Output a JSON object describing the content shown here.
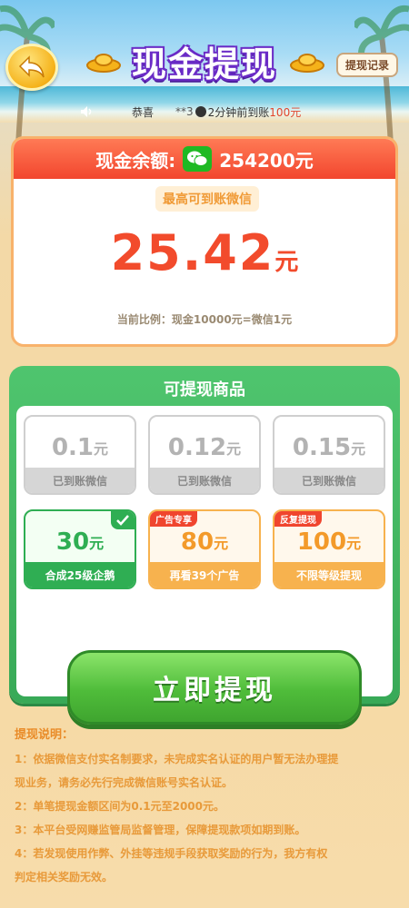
{
  "header": {
    "title": "现金提现",
    "record_label": "提现记录"
  },
  "ticker": {
    "prefix": "恭喜",
    "user": "**3",
    "message": "2分钟前到账",
    "amount": "100元"
  },
  "balance": {
    "label": "现金余额:",
    "amount": "254200元",
    "max_label": "最高可到账微信",
    "max_value": "25.42",
    "max_unit": "元",
    "ratio": "当前比例：现金10000元=微信1元"
  },
  "goods": {
    "title": "可提现商品",
    "items": [
      {
        "value": "0.1",
        "unit": "元",
        "sub": "已到账微信",
        "state": "done"
      },
      {
        "value": "0.12",
        "unit": "元",
        "sub": "已到账微信",
        "state": "done"
      },
      {
        "value": "0.15",
        "unit": "元",
        "sub": "已到账微信",
        "state": "done"
      },
      {
        "value": "30",
        "unit": "元",
        "sub": "合成25级企鹅",
        "state": "selected"
      },
      {
        "value": "80",
        "unit": "元",
        "sub": "再看39个广告",
        "tag": "广告专享",
        "state": "locked"
      },
      {
        "value": "100",
        "unit": "元",
        "sub": "不限等级提现",
        "tag": "反复提现",
        "state": "locked"
      }
    ],
    "button_label": "立即提现"
  },
  "notes": {
    "title": "提现说明：",
    "lines": [
      "1：依据微信支付实名制要求，未完成实名认证的用户暂无法办理提",
      "现业务，请务必先行完成微信账号实名认证。",
      "2：单笔提现金额区间为0.1元至2000元。",
      "3：本平台受网赚监管局监督管理，保障提现款项如期到账。",
      "4：若发现使用作弊、外挂等违规手段获取奖励的行为，我方有权",
      "判定相关奖励无效。"
    ]
  },
  "colors": {
    "accent_red": "#f24b2c",
    "accent_green": "#2fae53",
    "accent_orange": "#f7b24e",
    "wechat_green": "#1fb923"
  }
}
